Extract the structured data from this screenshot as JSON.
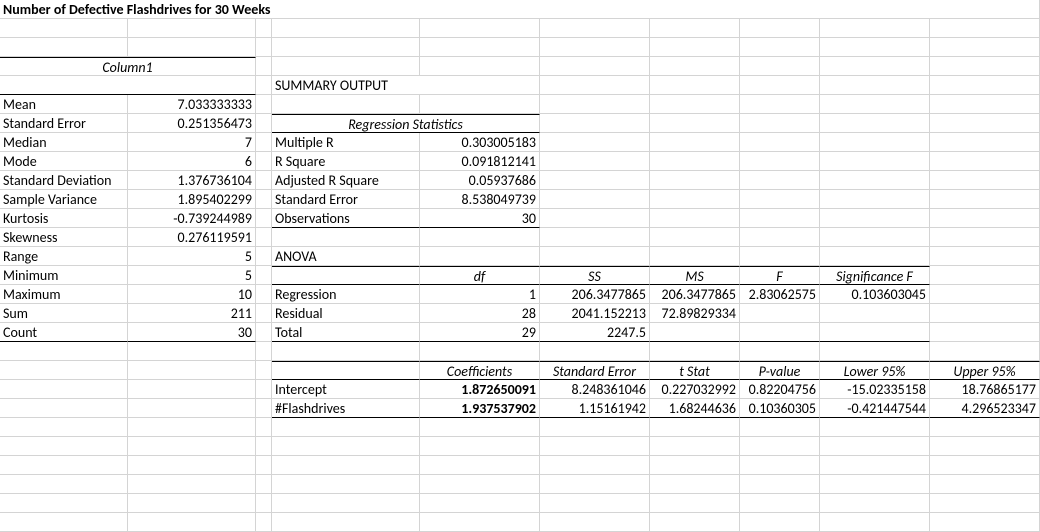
{
  "title": "Number of Defective Flashdrives for 30 Weeks",
  "col1_header": "Column1",
  "desc": {
    "mean_l": "Mean",
    "mean_v": "7.033333333",
    "se_l": "Standard Error",
    "se_v": "0.251356473",
    "median_l": "Median",
    "median_v": "7",
    "mode_l": "Mode",
    "mode_v": "6",
    "sd_l": "Standard Deviation",
    "sd_v": "1.376736104",
    "sv_l": "Sample Variance",
    "sv_v": "1.895402299",
    "kurt_l": "Kurtosis",
    "kurt_v": "-0.739244989",
    "skew_l": "Skewness",
    "skew_v": "0.276119591",
    "range_l": "Range",
    "range_v": "5",
    "min_l": "Minimum",
    "min_v": "5",
    "max_l": "Maximum",
    "max_v": "10",
    "sum_l": "Sum",
    "sum_v": "211",
    "count_l": "Count",
    "count_v": "30"
  },
  "summary_output": "SUMMARY OUTPUT",
  "reg_stats_title": "Regression Statistics",
  "reg": {
    "mr_l": "Multiple R",
    "mr_v": "0.303005183",
    "rsq_l": "R Square",
    "rsq_v": "0.091812141",
    "arsq_l": "Adjusted R Square",
    "arsq_v": "0.05937686",
    "se_l": "Standard Error",
    "se_v": "8.538049739",
    "obs_l": "Observations",
    "obs_v": "30"
  },
  "anova_title": "ANOVA",
  "anova_h": {
    "df": "df",
    "ss": "SS",
    "ms": "MS",
    "f": "F",
    "sigf": "Significance F"
  },
  "anova": {
    "reg_l": "Regression",
    "reg_df": "1",
    "reg_ss": "206.3477865",
    "reg_ms": "206.3477865",
    "reg_f": "2.83062575",
    "reg_sig": "0.103603045",
    "res_l": "Residual",
    "res_df": "28",
    "res_ss": "2041.152213",
    "res_ms": "72.89829334",
    "tot_l": "Total",
    "tot_df": "29",
    "tot_ss": "2247.5"
  },
  "coef_h": {
    "coef": "Coefficients",
    "se": "Standard Error",
    "t": "t Stat",
    "p": "P-value",
    "l95": "Lower 95%",
    "u95": "Upper 95%"
  },
  "coef": {
    "int_l": "Intercept",
    "int_c": "1.872650091",
    "int_se": "8.248361046",
    "int_t": "0.227032992",
    "int_p": "0.82204756",
    "int_l95": "-15.02335158",
    "int_u95": "18.76865177",
    "fd_l": "#Flashdrives",
    "fd_c": "1.937537902",
    "fd_se": "1.15161942",
    "fd_t": "1.68244636",
    "fd_p": "0.10360305",
    "fd_l95": "-0.421447544",
    "fd_u95": "4.296523347"
  }
}
